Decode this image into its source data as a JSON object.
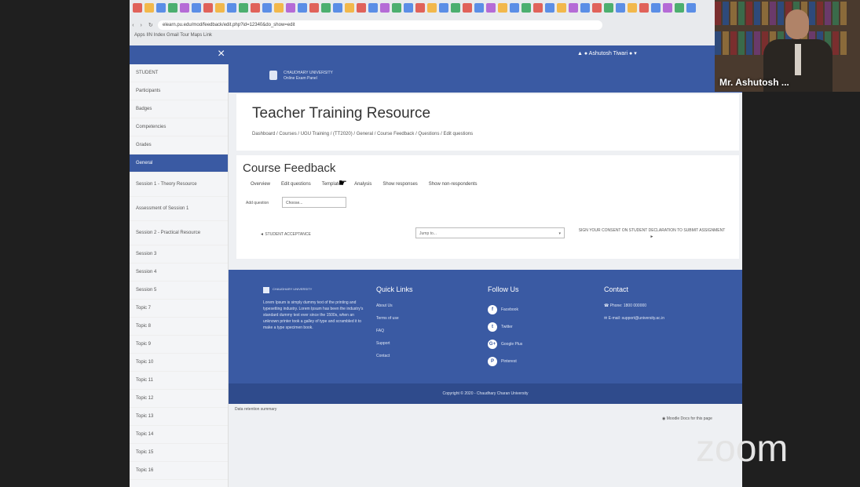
{
  "browser": {
    "url": "elearn.pu.edu/mod/feedback/edit.php?id=12340&do_show=edit",
    "bookmarks": "Apps  IIN Index  Gmail  Tour  Maps  Link"
  },
  "topbar": {
    "close_glyph": "×",
    "user_name": "Ashutosh Tiwari"
  },
  "brand": {
    "line1": "CHAUDHARY UNIVERSITY",
    "line2": "Online Exam Panel"
  },
  "sidebar": {
    "items": [
      {
        "label": "STUDENT"
      },
      {
        "label": "Participants"
      },
      {
        "label": "Badges"
      },
      {
        "label": "Competencies"
      },
      {
        "label": "Grades"
      },
      {
        "label": "General"
      },
      {
        "label": "Session 1 - Theory Resource"
      },
      {
        "label": "Assessment of Session 1"
      },
      {
        "label": "Session 2 - Practical Resource"
      },
      {
        "label": "Session 3"
      },
      {
        "label": "Session 4"
      },
      {
        "label": "Session 5"
      },
      {
        "label": "Topic 7"
      },
      {
        "label": "Topic 8"
      },
      {
        "label": "Topic 9"
      },
      {
        "label": "Topic 10"
      },
      {
        "label": "Topic 11"
      },
      {
        "label": "Topic 12"
      },
      {
        "label": "Topic 13"
      },
      {
        "label": "Topic 14"
      },
      {
        "label": "Topic 15"
      },
      {
        "label": "Topic 16"
      }
    ]
  },
  "page": {
    "title": "Teacher Training Resource",
    "breadcrumb": "Dashboard / Courses / UGU Training / (TT2020) / General / Course Feedback / Questions / Edit questions"
  },
  "feedback": {
    "title": "Course Feedback",
    "tabs": [
      "Overview",
      "Edit questions",
      "Templates",
      "Analysis",
      "Show responses",
      "Show non-respondents"
    ],
    "edit_label": "Add question",
    "edit_select": "Choose...",
    "acceptance_link": "◄ STUDENT ACCEPTANCE",
    "jump_to": "Jump to...",
    "next_link": "SIGN YOUR CONSENT ON STUDENT DECLARATION TO SUBMIT ASSIGNMENT ►"
  },
  "footer": {
    "logo_text": "CHAUDHARY UNIVERSITY",
    "about": "Lorem Ipsum is simply dummy text of the printing and typesetting industry. Lorem Ipsum has been the industry's standard dummy text ever since the 1500s, when an unknown printer took a galley of type and scrambled it to make a type specimen book.",
    "quick_links_title": "Quick Links",
    "quick_links": [
      "About Us",
      "Terms of use",
      "FAQ",
      "Support",
      "Contact"
    ],
    "follow_title": "Follow Us",
    "follow": [
      {
        "glyph": "f",
        "label": "Facebook"
      },
      {
        "glyph": "t",
        "label": "Twitter"
      },
      {
        "glyph": "G+",
        "label": "Google Plus"
      },
      {
        "glyph": "P",
        "label": "Pinterest"
      }
    ],
    "contact_title": "Contact",
    "phone": "Phone: 1800 000000",
    "email": "E-mail: support@university.ac.in",
    "copyright": "Copyright © 2020 - Chaudhary Charan University"
  },
  "below": {
    "summary": "Data retention summary",
    "docs": "Moodle Docs for this page"
  },
  "camera": {
    "name": "Mr. Ashutosh ..."
  },
  "zoom_logo": "zoom",
  "colors": {
    "brand_blue": "#3a5aa3",
    "footer_dark": "#2f4b8c",
    "background": "#1f1f1f"
  }
}
